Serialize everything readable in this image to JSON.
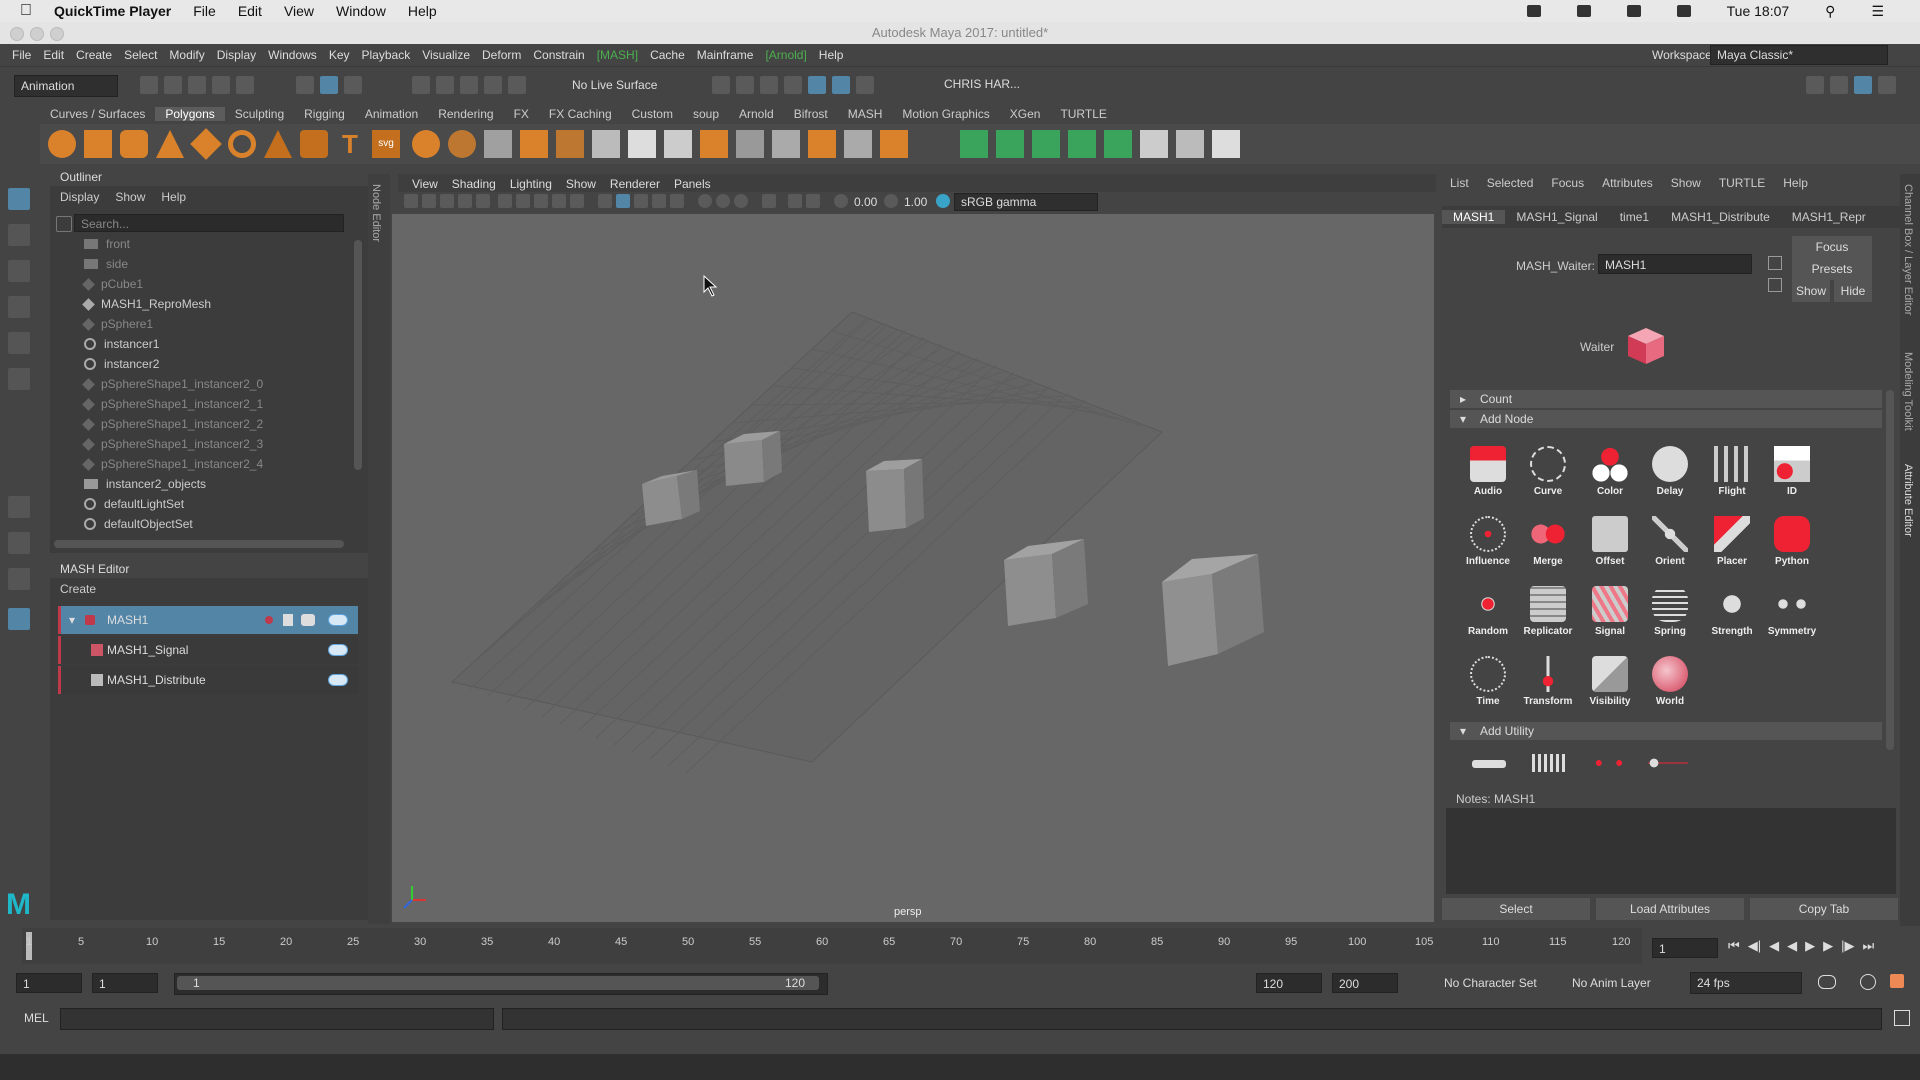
{
  "mac_menu": {
    "app": "QuickTime Player",
    "items": [
      "File",
      "Edit",
      "View",
      "Window",
      "Help"
    ],
    "clock": "Tue 18:07"
  },
  "window_title": "Autodesk Maya 2017: untitled*",
  "maya_menu": [
    "File",
    "Edit",
    "Create",
    "Select",
    "Modify",
    "Display",
    "Windows",
    "Key",
    "Playback",
    "Visualize",
    "Deform",
    "Constrain",
    "[MASH]",
    "Cache",
    "Mainframe",
    "[Arnold]",
    "Help"
  ],
  "workspace": {
    "label": "Workspace :",
    "value": "Maya Classic*"
  },
  "status": {
    "menu_set": "Animation",
    "live_surface": "No Live Surface",
    "user": "CHRIS HAR..."
  },
  "shelf_tabs": [
    "Curves / Surfaces",
    "Polygons",
    "Sculpting",
    "Rigging",
    "Animation",
    "Rendering",
    "FX",
    "FX Caching",
    "Custom",
    "soup",
    "Arnold",
    "Bifrost",
    "MASH",
    "Motion Graphics",
    "XGen",
    "TURTLE"
  ],
  "outliner": {
    "title": "Outliner",
    "menu": [
      "Display",
      "Show",
      "Help"
    ],
    "search_placeholder": "Search...",
    "items": [
      {
        "label": "front",
        "dim": true
      },
      {
        "label": "side",
        "dim": true
      },
      {
        "label": "pCube1",
        "dim": true
      },
      {
        "label": "MASH1_ReproMesh",
        "dim": false
      },
      {
        "label": "pSphere1",
        "dim": true
      },
      {
        "label": "instancer1",
        "dim": false
      },
      {
        "label": "instancer2",
        "dim": false
      },
      {
        "label": "pSphereShape1_instancer2_0",
        "dim": true
      },
      {
        "label": "pSphereShape1_instancer2_1",
        "dim": true
      },
      {
        "label": "pSphereShape1_instancer2_2",
        "dim": true
      },
      {
        "label": "pSphereShape1_instancer2_3",
        "dim": true
      },
      {
        "label": "pSphereShape1_instancer2_4",
        "dim": true
      },
      {
        "label": "instancer2_objects",
        "dim": false
      },
      {
        "label": "defaultLightSet",
        "dim": false
      },
      {
        "label": "defaultObjectSet",
        "dim": false
      }
    ]
  },
  "mash_editor": {
    "title": "MASH Editor",
    "create": "Create",
    "nodes": [
      "MASH1",
      "MASH1_Signal",
      "MASH1_Distribute"
    ]
  },
  "viewport": {
    "menu": [
      "View",
      "Shading",
      "Lighting",
      "Show",
      "Renderer",
      "Panels"
    ],
    "exposure": "0.00",
    "gamma": "1.00",
    "color_space": "sRGB gamma",
    "camera": "persp"
  },
  "attr_editor": {
    "menu": [
      "List",
      "Selected",
      "Focus",
      "Attributes",
      "Show",
      "TURTLE",
      "Help"
    ],
    "tabs": [
      "MASH1",
      "MASH1_Signal",
      "time1",
      "MASH1_Distribute",
      "MASH1_Repr"
    ],
    "waiter_label": "MASH_Waiter:",
    "waiter_value": "MASH1",
    "buttons": {
      "focus": "Focus",
      "presets": "Presets",
      "show": "Show",
      "hide": "Hide"
    },
    "waiter_text": "Waiter",
    "sections": {
      "count": "Count",
      "add_node": "Add Node",
      "add_utility": "Add Utility"
    },
    "nodes": [
      "Audio",
      "Curve",
      "Color",
      "Delay",
      "Flight",
      "ID",
      "Influence",
      "Merge",
      "Offset",
      "Orient",
      "Placer",
      "Python",
      "Random",
      "Replicator",
      "Signal",
      "Spring",
      "Strength",
      "Symmetry",
      "Time",
      "Transform",
      "Visibility",
      "World"
    ],
    "notes_label": "Notes:  MASH1",
    "bottom_buttons": [
      "Select",
      "Load Attributes",
      "Copy Tab"
    ]
  },
  "side_tabs": [
    "Channel Box / Layer Editor",
    "Modeling Toolkit",
    "Attribute Editor"
  ],
  "timeline": {
    "ticks": [
      "1",
      "5",
      "10",
      "15",
      "20",
      "25",
      "30",
      "35",
      "40",
      "45",
      "50",
      "55",
      "60",
      "65",
      "70",
      "75",
      "80",
      "85",
      "90",
      "95",
      "100",
      "105",
      "110",
      "115",
      "120"
    ],
    "current_frame": "1"
  },
  "range": {
    "start": "1",
    "playback_start": "1",
    "slider_start": "1",
    "slider_end": "120",
    "playback_end": "120",
    "end": "200",
    "character_set": "No Character Set",
    "anim_layer": "No Anim Layer",
    "fps": "24 fps"
  },
  "mel": {
    "label": "MEL"
  },
  "colors": {
    "accent": "#c0394b",
    "selection": "#5285a6",
    "toggle": "#5fa6e0"
  }
}
